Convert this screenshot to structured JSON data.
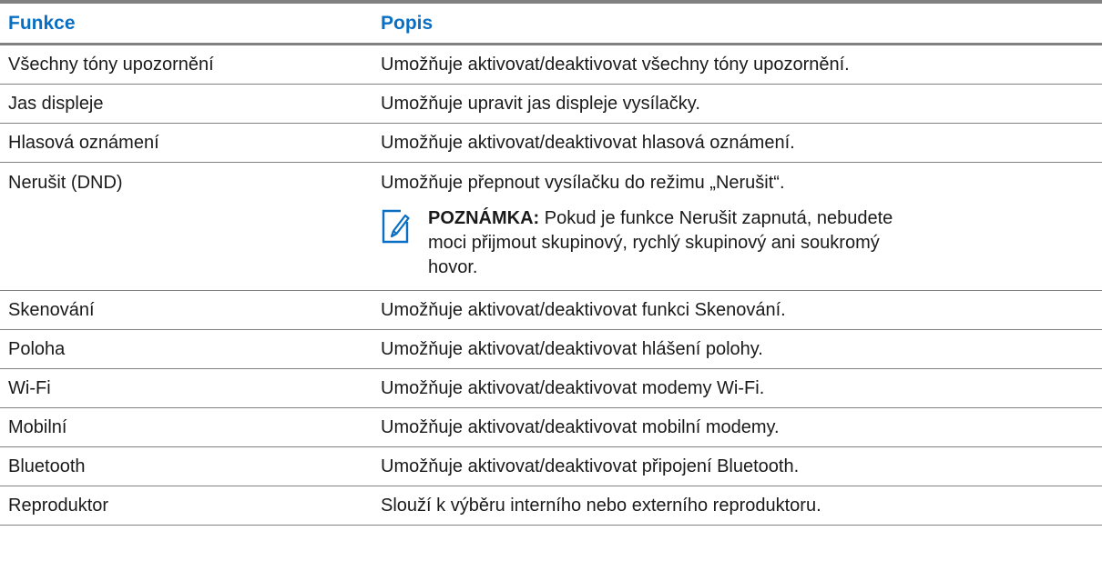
{
  "header": {
    "col1": "Funkce",
    "col2": "Popis"
  },
  "rows": [
    {
      "feature": "Všechny tóny upozornění",
      "description": "Umožňuje aktivovat/deaktivovat všechny tóny upozornění."
    },
    {
      "feature": "Jas displeje",
      "description": "Umožňuje upravit jas displeje vysílačky."
    },
    {
      "feature": "Hlasová oznámení",
      "description": "Umožňuje aktivovat/deaktivovat hlasová oznámení."
    },
    {
      "feature": "Nerušit (DND)",
      "description": "Umožňuje přepnout vysílačku do režimu „Nerušit“."
    },
    {
      "feature": "Skenování",
      "description": "Umožňuje aktivovat/deaktivovat funkci Skenování."
    },
    {
      "feature": "Poloha",
      "description": "Umožňuje aktivovat/deaktivovat hlášení polohy."
    },
    {
      "feature": "Wi-Fi",
      "description": "Umožňuje aktivovat/deaktivovat modemy Wi-Fi."
    },
    {
      "feature": "Mobilní",
      "description": "Umožňuje aktivovat/deaktivovat mobilní modemy."
    },
    {
      "feature": "Bluetooth",
      "description": "Umožňuje aktivovat/deaktivovat připojení Bluetooth."
    },
    {
      "feature": "Reproduktor",
      "description": "Slouží k výběru interního nebo externího reproduktoru."
    }
  ],
  "note": {
    "label": "POZNÁMKA:",
    "text": " Pokud je funkce Nerušit zapnutá, nebudete moci přijmout skupinový, rychlý skupinový ani soukromý hovor.",
    "icon": "note-pencil-icon"
  },
  "colors": {
    "header_text": "#0a6fc2",
    "rule": "#808080",
    "icon": "#0a6fc2"
  }
}
